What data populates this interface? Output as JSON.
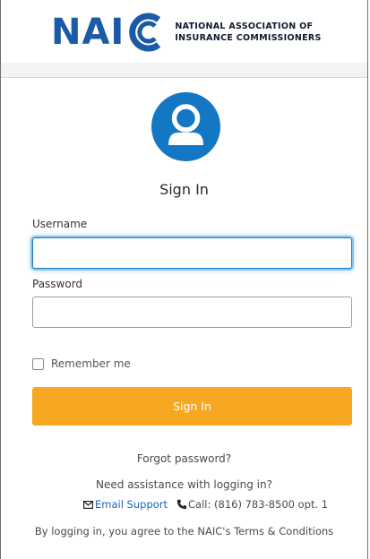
{
  "header": {
    "logo_word": "NAI",
    "org_line1": "NATIONAL ASSOCIATION OF",
    "org_line2": "INSURANCE COMMISSIONERS"
  },
  "form": {
    "title": "Sign In",
    "username_label": "Username",
    "username_value": "",
    "password_label": "Password",
    "password_value": "",
    "remember_label": "Remember me",
    "remember_checked": false,
    "submit_label": "Sign In"
  },
  "help": {
    "forgot_label": "Forgot password?",
    "assist_text": "Need assistance with logging in?",
    "email_label": "Email Support",
    "phone_label": "Call: (816) 783-8500 opt. 1",
    "terms_text": "By logging in, you agree to the NAIC's Terms & Conditions"
  },
  "colors": {
    "brand_blue": "#1a5aa6",
    "button_orange": "#f6a823",
    "link_blue": "#1a66b5",
    "focus_ring": "#5aaae6"
  },
  "icons": {
    "avatar": "user-avatar-icon",
    "email": "envelope-icon",
    "phone": "phone-icon"
  }
}
